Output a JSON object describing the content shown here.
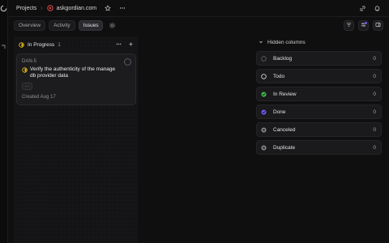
{
  "breadcrumb": {
    "root": "Projects",
    "project": "askgordian.com"
  },
  "tabs": [
    {
      "label": "Overview",
      "active": false
    },
    {
      "label": "Activity",
      "active": false
    },
    {
      "label": "Issues",
      "active": true
    }
  ],
  "column": {
    "title": "In Progress",
    "count": "1",
    "status_color": "#e2b714",
    "card": {
      "id": "DAN-5",
      "title": "Verify the authenticity of the manage db provider data",
      "tag": "···",
      "created": "Created Aug 17"
    }
  },
  "hidden_columns": {
    "label": "Hidden columns",
    "items": [
      {
        "name": "Backlog",
        "count": "0",
        "icon": "backlog-dashed-circle-icon"
      },
      {
        "name": "Todo",
        "count": "0",
        "icon": "todo-circle-icon"
      },
      {
        "name": "In Review",
        "count": "0",
        "icon": "in-review-check-icon",
        "color": "#3fb950"
      },
      {
        "name": "Done",
        "count": "0",
        "icon": "done-check-icon",
        "color": "#6a5cf5"
      },
      {
        "name": "Canceled",
        "count": "0",
        "icon": "canceled-x-icon",
        "color": "#8a8a90"
      },
      {
        "name": "Duplicate",
        "count": "0",
        "icon": "duplicate-x-icon",
        "color": "#8a8a90"
      }
    ]
  },
  "icons": {
    "app_logo": "app-logo-icon",
    "project": "project-icon",
    "star": "star-icon",
    "more": "more-icon",
    "link": "link-icon",
    "bell": "bell-icon",
    "gear": "gear-icon",
    "filter": "filter-icon",
    "display": "display-options-icon",
    "panel": "panel-toggle-icon"
  }
}
